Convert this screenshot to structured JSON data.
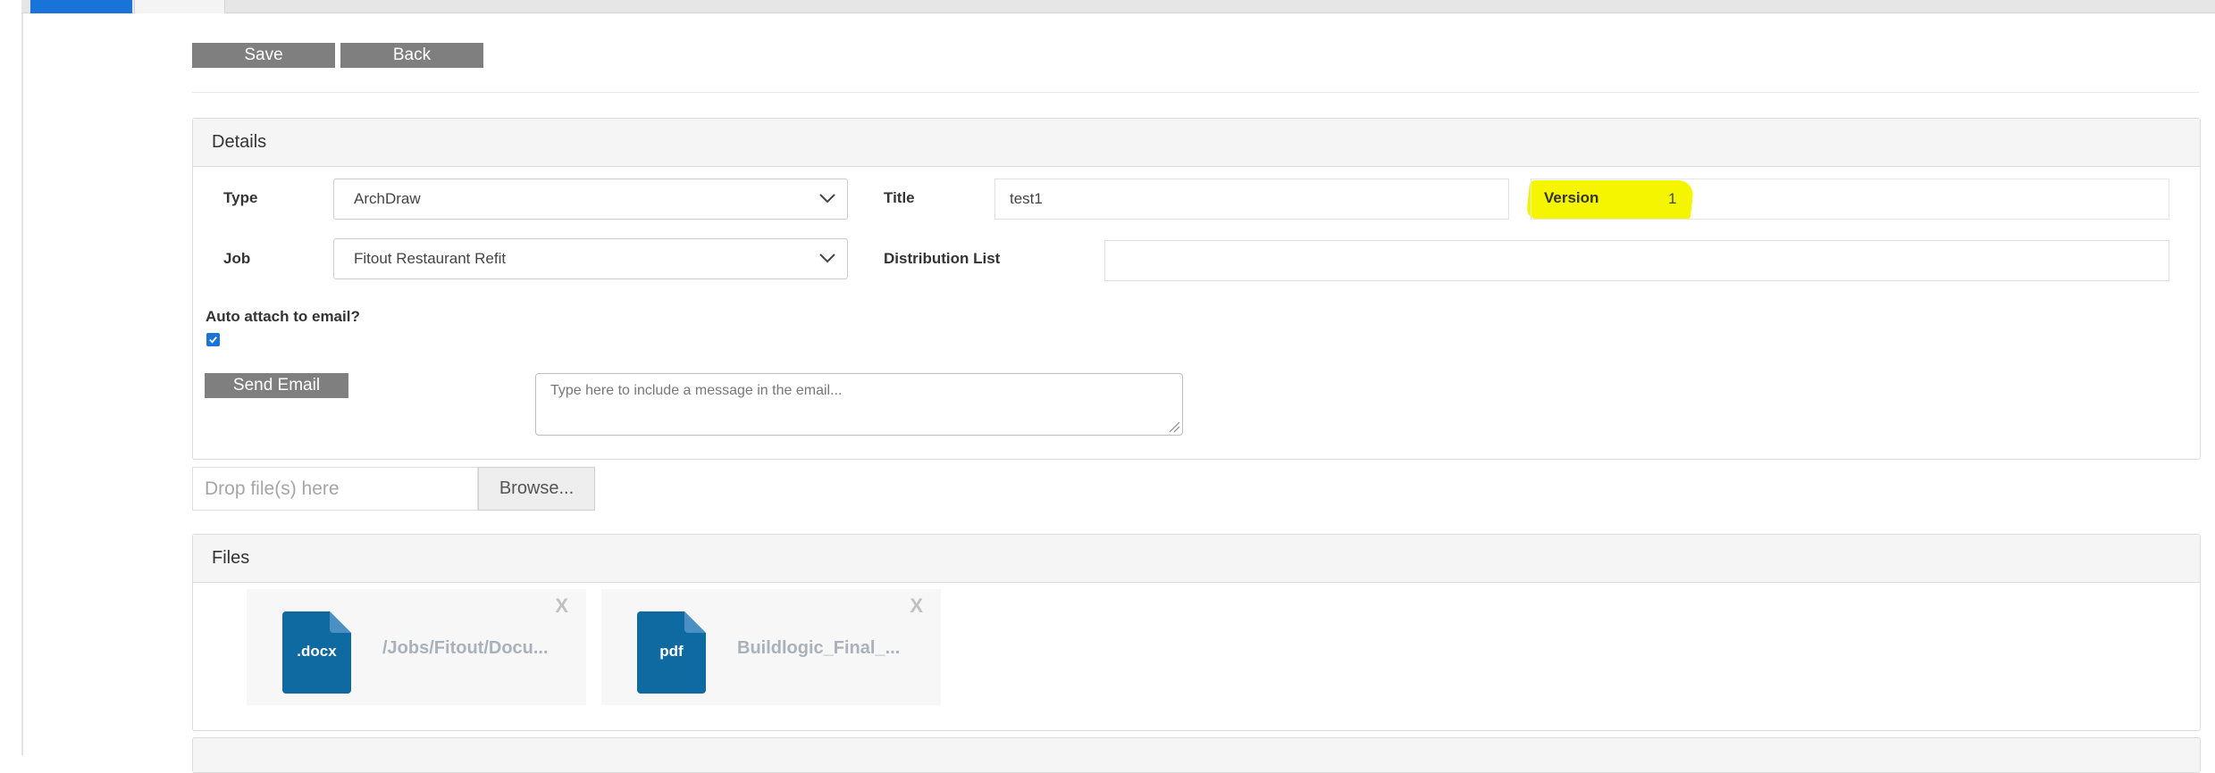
{
  "toolbar": {
    "save_label": "Save",
    "back_label": "Back"
  },
  "details": {
    "header": "Details",
    "type_label": "Type",
    "type_value": "ArchDraw",
    "title_label": "Title",
    "title_value": "test1",
    "version_label": "Version",
    "version_value": "1",
    "job_label": "Job",
    "job_value": "Fitout Restaurant Refit",
    "distribution_label": "Distribution List",
    "distribution_value": "",
    "auto_attach_label": "Auto attach to email?",
    "auto_attach_checked": true,
    "send_email_label": "Send Email",
    "message_placeholder": "Type here to include a message in the email..."
  },
  "upload": {
    "drop_placeholder": "Drop file(s) here",
    "browse_label": "Browse..."
  },
  "files": {
    "header": "Files",
    "close_label": "X",
    "items": [
      {
        "ext": ".docx",
        "name": "/Jobs/Fitout/Docu..."
      },
      {
        "ext": "pdf",
        "name": "Buildlogic_Final_..."
      }
    ]
  },
  "colors": {
    "accent": "#1a73d9",
    "button_gray": "#7f7f7f",
    "file_icon": "#0f6aa2",
    "highlight": "#f6f500"
  }
}
